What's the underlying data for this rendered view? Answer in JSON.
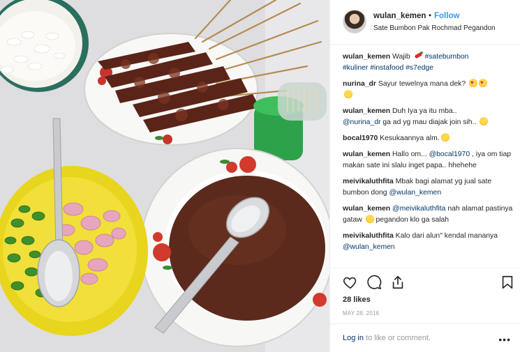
{
  "post": {
    "username": "wulan_kemen",
    "dot": "•",
    "follow_label": "Follow",
    "location": "Sate Bumbon Pak Rochmad Pegandon"
  },
  "caption": {
    "username": "wulan_kemen",
    "text": "Wajib",
    "hashtags_1": "#satebumbon",
    "hashtags_2": "#kuliner #instafood #s7edge"
  },
  "comments": [
    {
      "username": "nurina_dr",
      "text": "Sayur tewelnya mana dek?"
    },
    {
      "username": "wulan_kemen",
      "text": "Duh Iya ya itu mba..",
      "mention": "@nurina_dr",
      "text2": "ga ad yg mau diajak join sih.."
    },
    {
      "username": "bocal1970",
      "text": "Kesukaannya alm."
    },
    {
      "username": "wulan_kemen",
      "text": "Hallo om...",
      "mention": "@bocal1970",
      "text2": ", iya om tiap makan sate ini slalu inget papa.. hhehehe"
    },
    {
      "username": "meivikaluthfita",
      "text": "Mbak bagi alamat yg jual sate bumbon dong",
      "mention": "@wulan_kemen"
    },
    {
      "username": "wulan_kemen",
      "mention": "@meivikaluthfita",
      "text": "nah alamat pastinya gataw",
      "text2": "pegandon klo ga salah"
    },
    {
      "username": "meivikaluthfita",
      "text": "Kalo dari alun\" kendal mananya",
      "mention": "@wulan_kemen"
    }
  ],
  "actions": {
    "likes": "28 likes",
    "date": "MAY 28, 2016",
    "login_link": "Log in",
    "login_rest": " to like or comment.",
    "more": "•••"
  },
  "icons": [
    "heart-icon",
    "comment-icon",
    "share-icon",
    "bookmark-icon",
    "more-options-icon"
  ],
  "colors": {
    "accent": "#3897f0",
    "link": "#003569",
    "muted": "#999999",
    "text": "#262626"
  }
}
